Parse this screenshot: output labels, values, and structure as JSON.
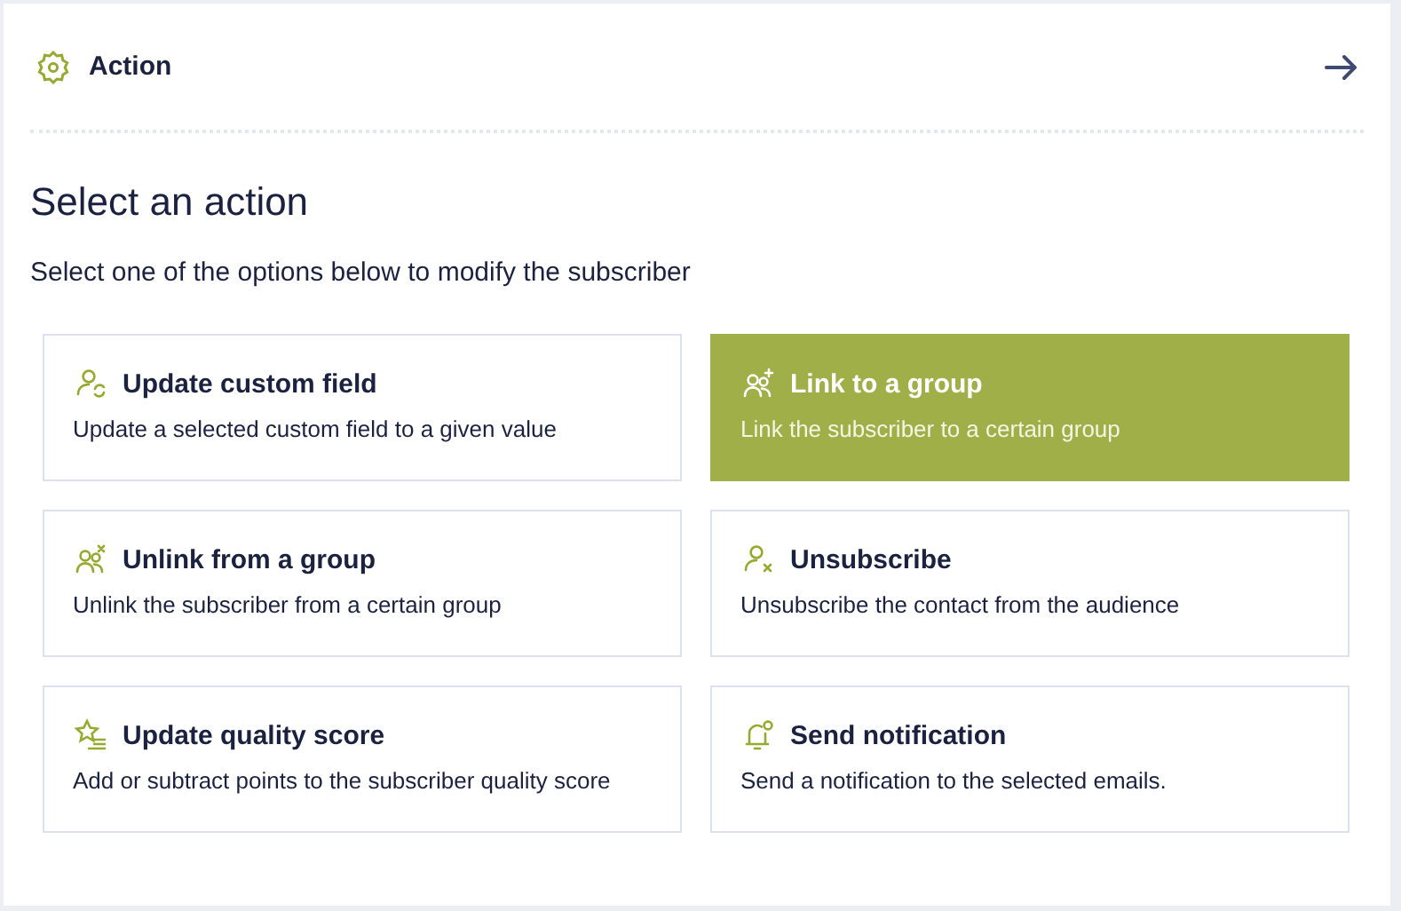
{
  "header": {
    "title": "Action"
  },
  "heading": "Select an action",
  "subtitle": "Select one of the options below to modify the subscriber",
  "options": [
    {
      "title": "Update custom field",
      "description": "Update a selected custom field to a given value",
      "selected": false
    },
    {
      "title": "Link to a group",
      "description": "Link the subscriber to a certain group",
      "selected": true
    },
    {
      "title": "Unlink from a group",
      "description": "Unlink the subscriber from a certain group",
      "selected": false
    },
    {
      "title": "Unsubscribe",
      "description": "Unsubscribe the contact from the audience",
      "selected": false
    },
    {
      "title": "Update quality score",
      "description": "Add or subtract points to the subscriber quality score",
      "selected": false
    },
    {
      "title": "Send notification",
      "description": "Send a notification to the selected emails.",
      "selected": false
    }
  ]
}
